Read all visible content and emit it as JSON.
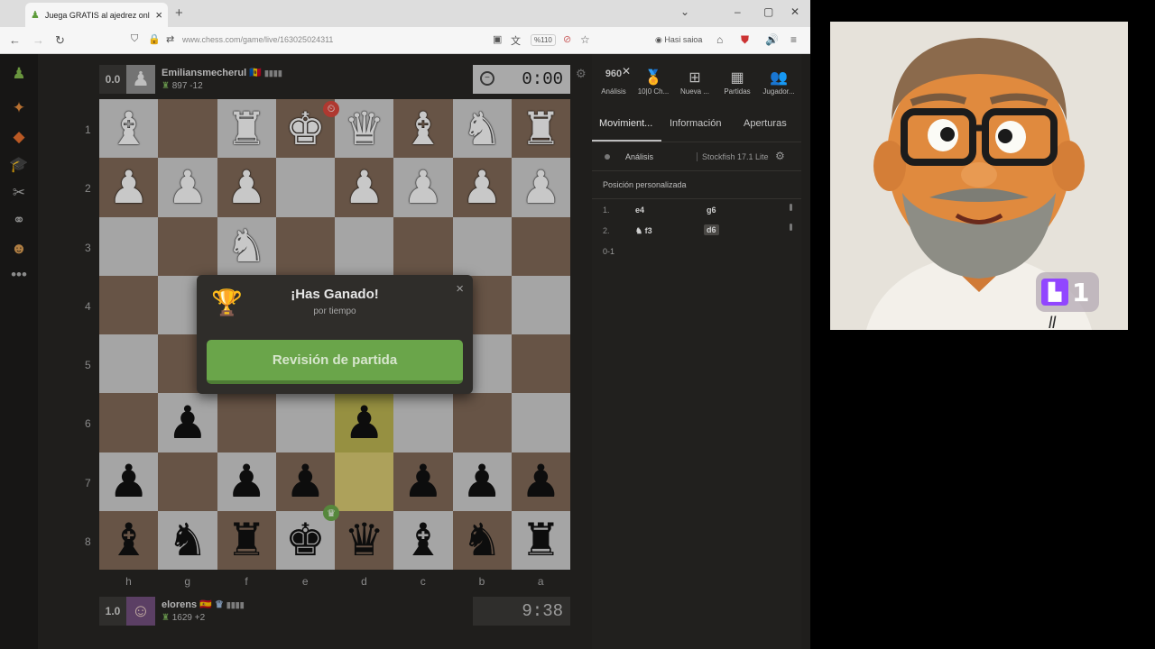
{
  "browser": {
    "tab_title": "Juega GRATIS al ajedrez online",
    "url": "www.chess.com/game/live/163025024311",
    "zoom": "%110",
    "account_label": "Hasi saioa"
  },
  "top_player": {
    "score": "0.0",
    "name": "Emiliansmecherul",
    "flag": "🇲🇩",
    "rating": "897 -12",
    "clock": "0:00"
  },
  "bottom_player": {
    "score": "1.0",
    "name": "elorens",
    "flag": "🇪🇸",
    "rating": "1629 +2",
    "clock": "9:38"
  },
  "board": {
    "orientation": "black",
    "ranks": [
      "1",
      "2",
      "3",
      "4",
      "5",
      "6",
      "7",
      "8"
    ],
    "files": [
      "h",
      "g",
      "f",
      "e",
      "d",
      "c",
      "b",
      "a"
    ],
    "rows": [
      [
        "wB",
        "",
        "wR",
        "wK",
        "wQ",
        "wB",
        "wN",
        "wR"
      ],
      [
        "wP",
        "wP",
        "wP",
        "",
        "wP",
        "wP",
        "wP",
        "wP"
      ],
      [
        "",
        "",
        "wN",
        "",
        "",
        "",
        "",
        ""
      ],
      [
        "",
        "",
        "",
        "",
        "",
        "",
        "",
        ""
      ],
      [
        "",
        "",
        "",
        "",
        "",
        "",
        "",
        ""
      ],
      [
        "",
        "bP",
        "",
        "",
        "bP",
        "",
        "",
        ""
      ],
      [
        "bP",
        "",
        "bP",
        "bP",
        "",
        "bP",
        "bP",
        "bP"
      ],
      [
        "bB",
        "bN",
        "bR",
        "bK",
        "bQ",
        "bB",
        "bN",
        "bR"
      ]
    ],
    "highlights": [
      [
        5,
        4
      ],
      [
        6,
        4
      ]
    ]
  },
  "modal": {
    "title": "¡Has Ganado!",
    "subtitle": "por tiempo",
    "button": "Revisión de partida"
  },
  "panel": {
    "tools": [
      "Análisis",
      "10|0 Ch...",
      "Nueva ...",
      "Partidas",
      "Jugador..."
    ],
    "tabs": [
      "Movimient...",
      "Información",
      "Aperturas"
    ],
    "analysis_label": "Análisis",
    "engine": "Stockfish 17.1 Lite",
    "custom_position": "Posición personalizada",
    "moves": [
      {
        "num": "1.",
        "white": "e4",
        "black": "g6"
      },
      {
        "num": "2.",
        "white": "♞ f3",
        "black": "d6"
      }
    ],
    "result": "0-1"
  },
  "stream": {
    "viewer_count": "1"
  }
}
